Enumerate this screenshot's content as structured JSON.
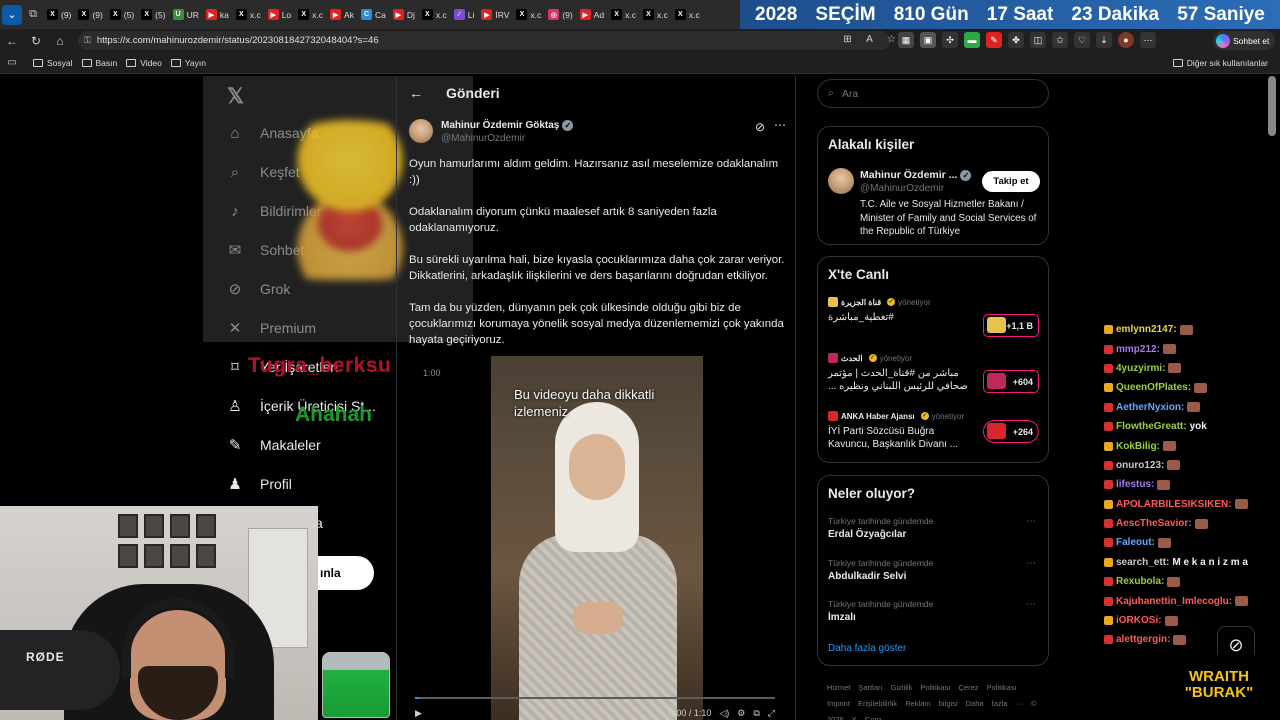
{
  "browser": {
    "tabs": [
      {
        "label": "(9)",
        "fav": "x"
      },
      {
        "label": "(9)",
        "fav": "x"
      },
      {
        "label": "(5)",
        "fav": "x"
      },
      {
        "label": "(5)",
        "fav": "x"
      },
      {
        "label": "UR",
        "fav": "green"
      },
      {
        "label": "ka",
        "fav": "red"
      },
      {
        "label": "x.c",
        "fav": "x"
      },
      {
        "label": "Lo",
        "fav": "red"
      },
      {
        "label": "x.c",
        "fav": "x"
      },
      {
        "label": "Ak",
        "fav": "red"
      },
      {
        "label": "Ca",
        "fav": "blue"
      },
      {
        "label": "Dj",
        "fav": "red"
      },
      {
        "label": "x.c",
        "fav": "x"
      },
      {
        "label": "Li",
        "fav": "purple"
      },
      {
        "label": "İRV",
        "fav": "red"
      },
      {
        "label": "x.c",
        "fav": "x"
      },
      {
        "label": "(9)",
        "fav": "insta"
      },
      {
        "label": "Ad",
        "fav": "red"
      },
      {
        "label": "x.c",
        "fav": "x"
      },
      {
        "label": "x.c",
        "fav": "x"
      },
      {
        "label": "x.c",
        "fav": "x"
      }
    ],
    "countdown": [
      "2028",
      "SEÇİM",
      "810 Gün",
      "17 Saat",
      "23 Dakika",
      "57 Saniye"
    ],
    "url": "https://x.com/mahinurozdemir/status/2023081842732048404?s=46",
    "chat_button": "Sohbet et",
    "bookmarks": [
      "Sosyal",
      "Basın",
      "Video",
      "Yayın"
    ],
    "other_bookmarks": "Diğer sık kullanılanlar"
  },
  "nav": {
    "items": [
      {
        "label": "Anasayfa",
        "icon": "home-icon",
        "glyph": "⌂"
      },
      {
        "label": "Keşfet",
        "icon": "search-icon",
        "glyph": "⌕"
      },
      {
        "label": "Bildirimler",
        "icon": "bell-icon",
        "glyph": "♪"
      },
      {
        "label": "Sohbet",
        "icon": "mail-icon",
        "glyph": "✉"
      },
      {
        "label": "Grok",
        "icon": "grok-icon",
        "glyph": "⊘"
      },
      {
        "label": "Premium",
        "icon": "x-premium-icon",
        "glyph": "✕"
      },
      {
        "label": "Yer İşaretleri",
        "icon": "bookmark-icon",
        "glyph": "⌑"
      },
      {
        "label": "İçerik Üreticisi St...",
        "icon": "creator-icon",
        "glyph": "♙"
      },
      {
        "label": "Makaleler",
        "icon": "article-icon",
        "glyph": "✎"
      },
      {
        "label": "Profil",
        "icon": "profile-icon",
        "glyph": "♟"
      }
    ],
    "more_fragment": "a",
    "post_fragment": "ınla"
  },
  "overlay": {
    "watermark1": "Tugra_berksu",
    "watermark2": "Ahahah"
  },
  "post": {
    "page_title": "Gönderi",
    "author": "Mahinur Özdemir Göktaş",
    "handle": "@MahinurOzdemir",
    "paragraphs": [
      "Oyun hamurlarımı aldım geldim. Hazırsanız asıl meselemize odaklanalım :))",
      "Odaklanalım diyorum çünkü maalesef artık 8 saniyeden fazla odaklanamıyoruz.",
      "Bu sürekli uyarılma hali, bize kıyasla çocuklarımıza daha çok zarar veriyor. Dikkatlerini, arkadaşlık ilişkilerini ve ders başarılarını doğrudan etkiliyor.",
      "Tam da bu yüzden, dünyanın pek çok ülkesinde olduğu gibi biz de çocuklarımızı korumaya yönelik sosyal medya düzenlememizi çok yakında hayata geçiriyoruz."
    ],
    "video": {
      "caption": "Bu videoyu daha dikkatli izlemeniz",
      "time_tl": "1:00",
      "time": "0:00 / 1:10",
      "progress": 0.01
    }
  },
  "right": {
    "search_placeholder": "Ara",
    "related": {
      "title": "Alakalı kişiler",
      "name": "Mahinur Özdemir ...",
      "handle": "@MahinurOzdemir",
      "follow": "Takip et",
      "bio": "T.C. Aile ve Sosyal Hizmetler Bakanı / Minister of Family and Social Services of the Republic of Türkiye"
    },
    "live": {
      "title": "X'te Canlı",
      "items": [
        {
          "host": "قناة الجزيرة",
          "role": "yönetiyor",
          "title": "#تغطية_مباشرة",
          "count": "+1,1 B",
          "color": "#e8c24a"
        },
        {
          "host": "الحدث",
          "role": "yönetiyor",
          "title": "مباشر من #قناة_الحدث | مؤتمر صحافي للرئيس اللبناني ونظيره ...",
          "count": "+604",
          "color": "#c0285a"
        },
        {
          "host": "ANKA Haber Ajansı",
          "role": "yönetiyor",
          "title": "İYİ Parti Sözcüsü Buğra Kavuncu, Başkanlık Divanı ...",
          "count": "+264",
          "color": "#d8262e"
        }
      ]
    },
    "trends": {
      "title": "Neler oluyor?",
      "items": [
        {
          "context": "Türkiye tarihinde gündemde",
          "name": "Erdal Özyağcılar"
        },
        {
          "context": "Türkiye tarihinde gündemde",
          "name": "Abdulkadir Selvi"
        },
        {
          "context": "Türkiye tarihinde gündemde",
          "name": "İmzalı"
        }
      ],
      "show_more": "Daha fazla göster"
    },
    "footer": "Hizmet Şartları  Gizlilik Politikası  Çerez Politikası  Imprint  Erişilebilirlik  Reklam bilgisi  Daha fazla ···  © 2026 X Corp."
  },
  "stream": {
    "chat": [
      {
        "user": "emlynn2147:",
        "msg": "",
        "color": "#e8d640"
      },
      {
        "user": "mmp212:",
        "msg": "",
        "color": "#a07cf0"
      },
      {
        "user": "4yuzyirmi:",
        "msg": "",
        "color": "#9ad13a"
      },
      {
        "user": "QueenOfPlates:",
        "msg": "",
        "color": "#9ad13a"
      },
      {
        "user": "AetherNyxion:",
        "msg": "",
        "color": "#5fa8ff"
      },
      {
        "user": "FlowtheGreatt:",
        "msg": "yok",
        "color": "#9ad13a"
      },
      {
        "user": "KokBilig:",
        "msg": "",
        "color": "#9ad13a"
      },
      {
        "user": "onuro123:",
        "msg": "",
        "color": "#c8c8c8"
      },
      {
        "user": "lifestus:",
        "msg": "",
        "color": "#a07cf0"
      },
      {
        "user": "APOLARBILESIKSIKEN:",
        "msg": "",
        "color": "#ff5a5a"
      },
      {
        "user": "AescTheSavior:",
        "msg": "",
        "color": "#ff5a5a"
      },
      {
        "user": "Faleout:",
        "msg": "",
        "color": "#5fa8ff"
      },
      {
        "user": "search_ett:",
        "msg": "M e k a n i z m a",
        "color": "#c8c8c8"
      },
      {
        "user": "Rexubola:",
        "msg": "",
        "color": "#9ad13a"
      },
      {
        "user": "Kajuhanettin_Imlecoglu:",
        "msg": "",
        "color": "#ff5a5a"
      },
      {
        "user": "iORKOSi:",
        "msg": "",
        "color": "#ff5a5a"
      },
      {
        "user": "alettgergin:",
        "msg": "",
        "color": "#ff5a5a"
      }
    ],
    "logo_line1": "WRAITH",
    "logo_line2": "\"BURAK\"",
    "mic_brand": "RØDE"
  }
}
